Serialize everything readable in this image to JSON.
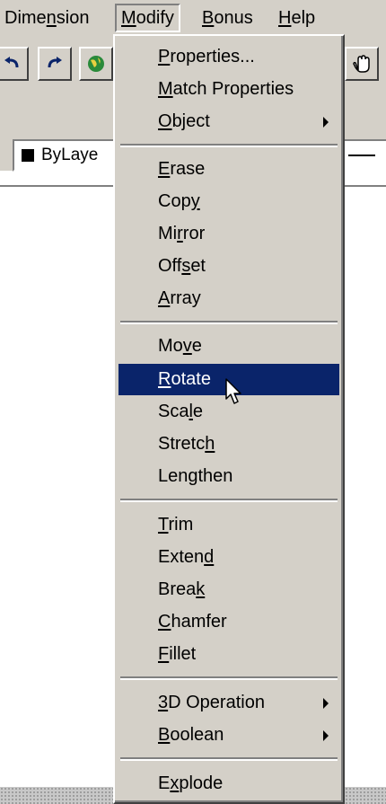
{
  "menubar": {
    "items": [
      {
        "pre": "Dime",
        "key": "n",
        "post": "sion"
      },
      {
        "pre": "",
        "key": "M",
        "post": "odify"
      },
      {
        "pre": "",
        "key": "B",
        "post": "onus"
      },
      {
        "pre": "",
        "key": "H",
        "post": "elp"
      }
    ],
    "open_menu": "Modify"
  },
  "toolbar": {
    "layer_value": "ByLaye",
    "icons": [
      "undo-icon",
      "redo-icon",
      "globe-icon",
      "pan-icon"
    ]
  },
  "modify_menu": {
    "items": [
      {
        "pre": "",
        "key": "P",
        "post": "roperties..."
      },
      {
        "pre": "",
        "key": "M",
        "post": "atch Properties"
      },
      {
        "pre": "",
        "key": "O",
        "post": "bject",
        "submenu": true
      },
      {
        "pre": "",
        "key": "E",
        "post": "rase"
      },
      {
        "pre": "Cop",
        "key": "y",
        "post": ""
      },
      {
        "pre": "Mi",
        "key": "r",
        "post": "ror"
      },
      {
        "pre": "Off",
        "key": "s",
        "post": "et"
      },
      {
        "pre": "",
        "key": "A",
        "post": "rray"
      },
      {
        "pre": "Mo",
        "key": "v",
        "post": "e"
      },
      {
        "pre": "",
        "key": "R",
        "post": "otate",
        "selected": true
      },
      {
        "pre": "Sca",
        "key": "l",
        "post": "e"
      },
      {
        "pre": "Stretc",
        "key": "h",
        "post": ""
      },
      {
        "pre": "Len",
        "key": "g",
        "post": "then"
      },
      {
        "pre": "",
        "key": "T",
        "post": "rim"
      },
      {
        "pre": "Exten",
        "key": "d",
        "post": ""
      },
      {
        "pre": "Brea",
        "key": "k",
        "post": ""
      },
      {
        "pre": "",
        "key": "C",
        "post": "hamfer"
      },
      {
        "pre": "",
        "key": "F",
        "post": "illet"
      },
      {
        "pre": "",
        "key": "3",
        "post": "D Operation",
        "submenu": true
      },
      {
        "pre": "",
        "key": "B",
        "post": "oolean",
        "submenu": true
      },
      {
        "pre": "E",
        "key": "x",
        "post": "plode"
      }
    ],
    "selected_color": "#0a246a"
  }
}
